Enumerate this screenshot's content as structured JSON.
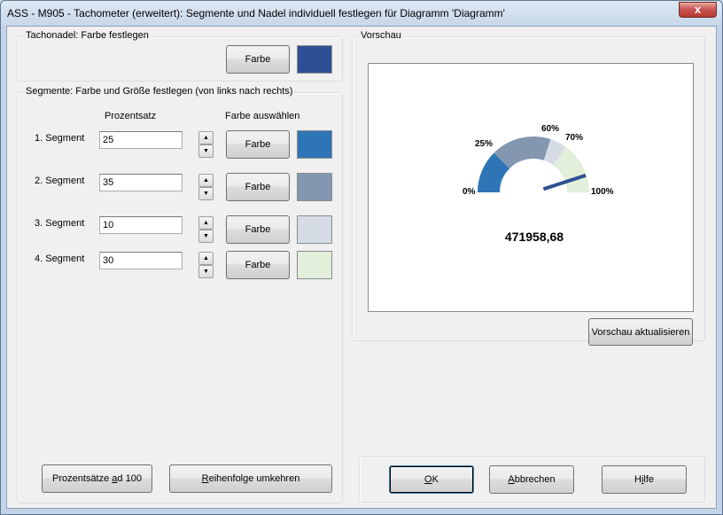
{
  "window": {
    "title": "ASS - M905 - Tachometer (erweitert): Segmente und Nadel individuell festlegen für Diagramm 'Diagramm'",
    "close_glyph": "x"
  },
  "needle_group": {
    "label": "Tachonadel: Farbe festlegen",
    "button": "Farbe",
    "color": "#2f4f94"
  },
  "segments_group": {
    "label": "Segmente: Farbe und Größe festlegen (von links nach rechts)",
    "col_percent": "Prozentsatz",
    "col_color": "Farbe auswählen",
    "segments": [
      {
        "label": "1. Segment",
        "value": "25",
        "button": "Farbe",
        "color": "#2e75b6"
      },
      {
        "label": "2. Segment",
        "value": "35",
        "button": "Farbe",
        "color": "#8497b0"
      },
      {
        "label": "3. Segment",
        "value": "10",
        "button": "Farbe",
        "color": "#d6dce5"
      },
      {
        "label": "4. Segment",
        "value": "30",
        "button": "Farbe",
        "color": "#e2efda"
      }
    ],
    "btn_ad100_pre": "Prozentsätze ",
    "btn_ad100_u": "a",
    "btn_ad100_post": "d 100",
    "btn_reverse_pre": "",
    "btn_reverse_u": "R",
    "btn_reverse_post": "eihenfolge umkehren"
  },
  "preview": {
    "label": "Vorschau",
    "value_text": "471958,68",
    "tick_labels": [
      "0%",
      "25%",
      "60%",
      "70%",
      "100%"
    ],
    "needle_color": "#2f4f94",
    "needle_fraction": 0.9,
    "button": "Vorschau aktualisieren"
  },
  "footer": {
    "ok_u": "O",
    "ok_post": "K",
    "cancel_pre": "",
    "cancel_u": "A",
    "cancel_post": "bbrechen",
    "help_pre": "H",
    "help_u": "i",
    "help_post": "lfe"
  }
}
